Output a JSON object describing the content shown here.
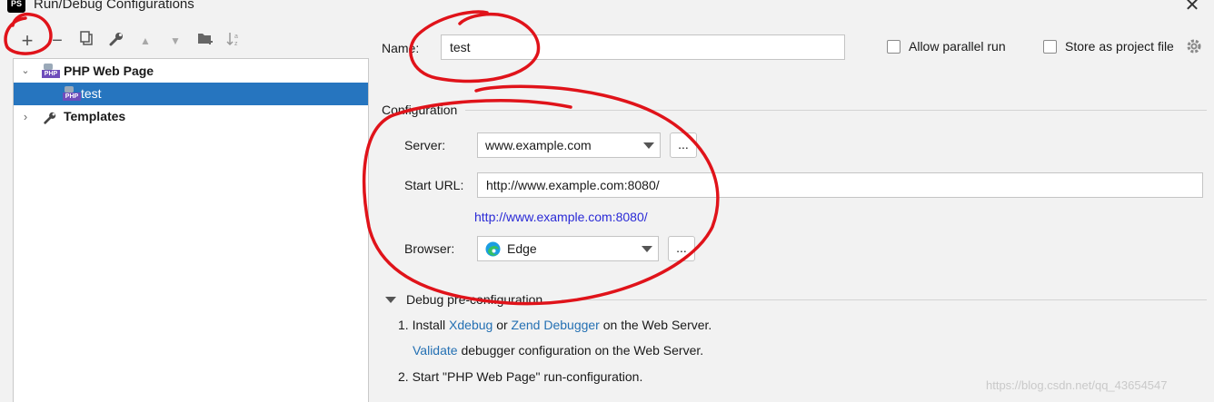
{
  "window": {
    "title": "Run/Debug Configurations",
    "app_badge": "PS"
  },
  "toolbar": {
    "add": "+",
    "remove": "−",
    "copy": "⧉",
    "edit": "🔧",
    "up": "▲",
    "down": "▼",
    "folder": "📁",
    "sort": "a↓z"
  },
  "tree": {
    "group_label": "PHP Web Page",
    "item_label": "test",
    "templates_label": "Templates",
    "php_badge": "PHP"
  },
  "form": {
    "name_label": "Name:",
    "name_value": "test",
    "allow_parallel_label": "Allow parallel run",
    "store_project_label": "Store as project file",
    "configuration_title": "Configuration",
    "server_label": "Server:",
    "server_value": "www.example.com",
    "browse_label": "...",
    "start_url_label": "Start URL:",
    "start_url_value": "http://www.example.com:8080/",
    "resolved_url": "http://www.example.com:8080/",
    "browser_label": "Browser:",
    "browser_value": "Edge"
  },
  "debug": {
    "title": "Debug pre-configuration",
    "step1_prefix": "1. Install",
    "xdebug": "Xdebug",
    "or": "or",
    "zend": "Zend Debugger",
    "step1_suffix": "on the Web Server.",
    "validate": "Validate",
    "validate_suffix": "debugger configuration on the Web Server.",
    "step2": "2. Start \"PHP Web Page\" run-configuration."
  },
  "watermark": "https://blog.csdn.net/qq_43654547",
  "colors": {
    "selection": "#2675bf",
    "link": "#2470b3",
    "annotation": "#e0131a"
  }
}
